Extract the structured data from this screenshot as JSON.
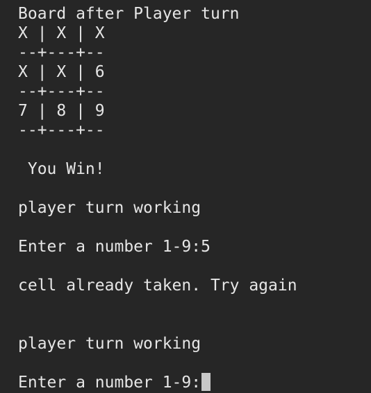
{
  "terminal": {
    "lines": [
      "Board after Player turn",
      "X | X | X",
      "--+---+--",
      "X | X | 6",
      "--+---+--",
      "7 | 8 | 9",
      "--+---+--",
      " You Win!",
      "player turn working",
      "Enter a number 1-9:5",
      "cell already taken. Try again",
      "player turn working",
      "Enter a number 1-9:"
    ]
  }
}
